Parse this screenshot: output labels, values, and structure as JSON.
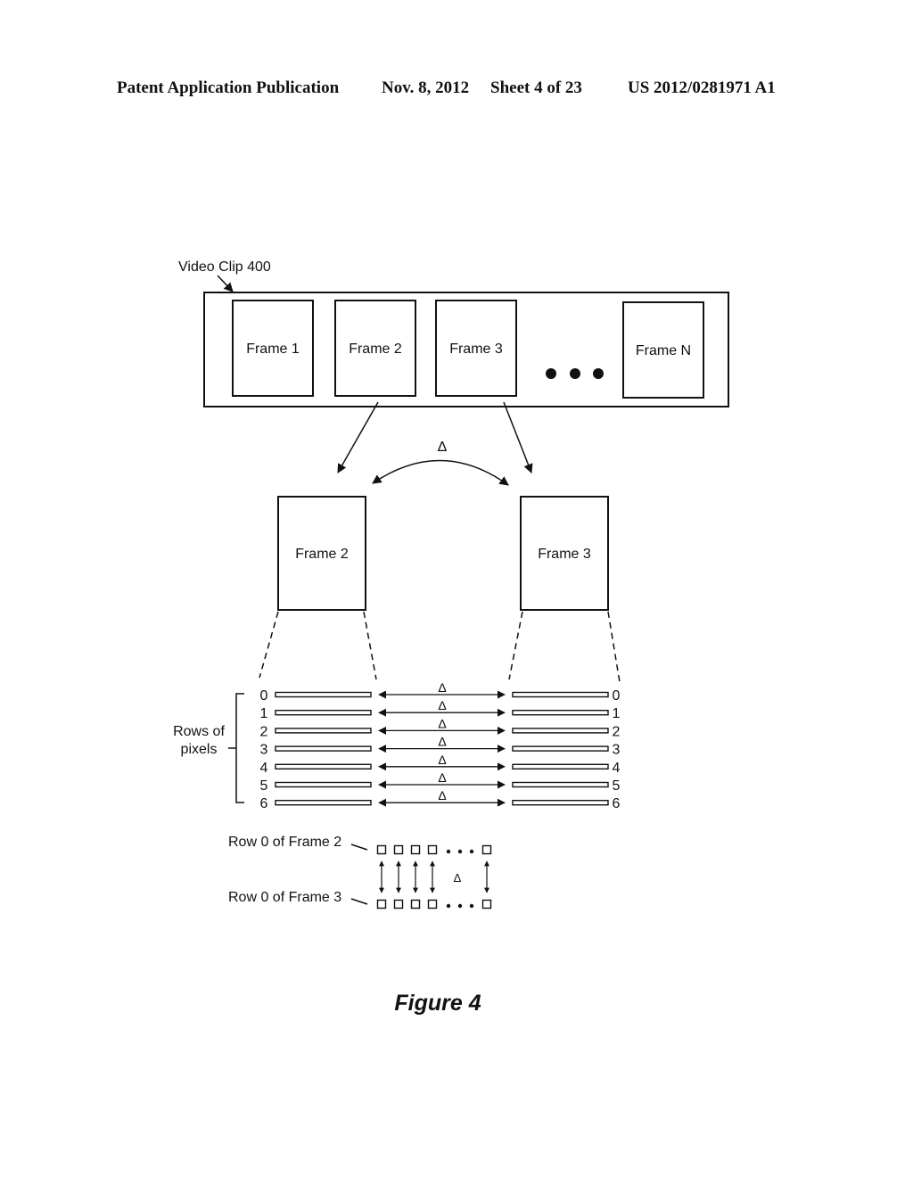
{
  "header": {
    "publication": "Patent Application Publication",
    "date": "Nov. 8, 2012",
    "sheet": "Sheet 4 of 23",
    "number": "US 2012/0281971 A1"
  },
  "diagram": {
    "clip_label": "Video Clip 400",
    "clip_frames": [
      "Frame 1",
      "Frame 2",
      "Frame 3",
      "Frame N"
    ],
    "ellipsis": "•••",
    "delta": "Δ",
    "compared_frames": [
      "Frame 2",
      "Frame 3"
    ],
    "rows_label_line1": "Rows of",
    "rows_label_line2": "pixels",
    "row_indices": [
      "0",
      "1",
      "2",
      "3",
      "4",
      "5",
      "6"
    ],
    "pixel_row_top_label": "Row 0 of Frame 2",
    "pixel_row_bottom_label": "Row 0 of Frame 3",
    "figure_caption": "Figure 4"
  }
}
